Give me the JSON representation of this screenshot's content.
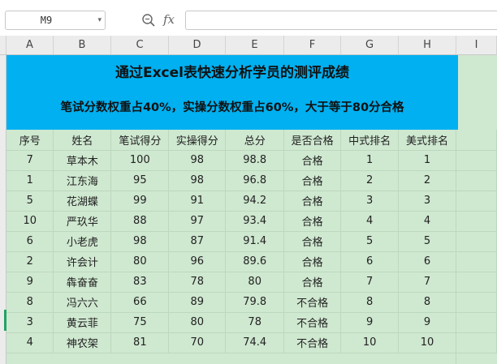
{
  "formula_bar": {
    "name_box": "M9",
    "name_box_caret": "▾",
    "fx_label": "fx",
    "formula": ""
  },
  "columns": [
    "A",
    "B",
    "C",
    "D",
    "E",
    "F",
    "G",
    "H",
    "I"
  ],
  "title": {
    "line1": "通过Excel表快速分析学员的测评成绩",
    "line2": "笔试分数权重占40%，实操分数权重占60%，大于等于80分合格"
  },
  "table": {
    "headers": [
      "序号",
      "姓名",
      "笔试得分",
      "实操得分",
      "总分",
      "是否合格",
      "中式排名",
      "美式排名"
    ],
    "rows": [
      [
        "7",
        "草本木",
        "100",
        "98",
        "98.8",
        "合格",
        "1",
        "1"
      ],
      [
        "1",
        "江东海",
        "95",
        "98",
        "96.8",
        "合格",
        "2",
        "2"
      ],
      [
        "5",
        "花湖蝶",
        "99",
        "91",
        "94.2",
        "合格",
        "3",
        "3"
      ],
      [
        "10",
        "严玖华",
        "88",
        "97",
        "93.4",
        "合格",
        "4",
        "4"
      ],
      [
        "6",
        "小老虎",
        "98",
        "87",
        "91.4",
        "合格",
        "5",
        "5"
      ],
      [
        "2",
        "许会计",
        "80",
        "96",
        "89.6",
        "合格",
        "6",
        "6"
      ],
      [
        "9",
        "犇奋奋",
        "83",
        "78",
        "80",
        "合格",
        "7",
        "7"
      ],
      [
        "8",
        "冯六六",
        "66",
        "89",
        "79.8",
        "不合格",
        "8",
        "8"
      ],
      [
        "3",
        "黄云菲",
        "75",
        "80",
        "78",
        "不合格",
        "9",
        "9"
      ],
      [
        "4",
        "神农架",
        "81",
        "70",
        "74.4",
        "不合格",
        "10",
        "10"
      ]
    ]
  },
  "colors": {
    "title_band": "#00b0f0",
    "cell_fill": "#cfe8d0"
  }
}
